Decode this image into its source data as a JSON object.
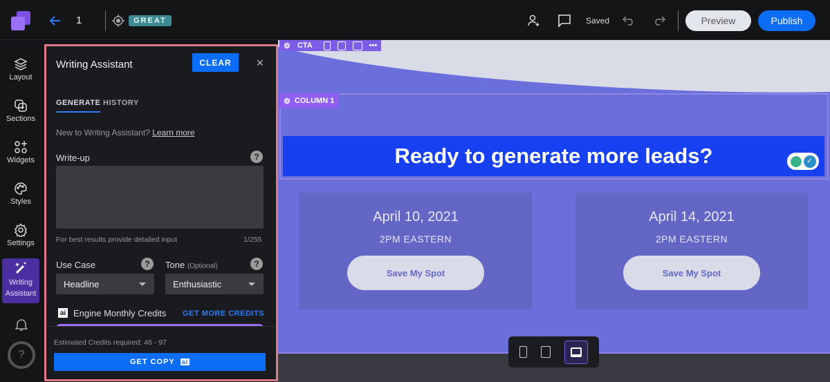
{
  "topbar": {
    "page_number": "1",
    "score_badge": "GREAT",
    "saved": "Saved",
    "preview": "Preview",
    "publish": "Publish"
  },
  "rail": {
    "items": [
      {
        "label": "Layout"
      },
      {
        "label": "Sections"
      },
      {
        "label": "Widgets"
      },
      {
        "label": "Styles"
      },
      {
        "label": "Settings"
      },
      {
        "label": "Writing Assistant"
      }
    ],
    "help": "?"
  },
  "panel": {
    "title": "Writing Assistant",
    "clear": "CLEAR",
    "tabs": [
      "GENERATE",
      "HISTORY"
    ],
    "intro": "New to Writing Assistant?",
    "learn_more": "Learn more",
    "writeup_label": "Write-up",
    "writeup_value": "",
    "hint": "For best results provide detailed input",
    "counter": "1/255",
    "use_case_label": "Use Case",
    "use_case_value": "Headline",
    "tone_label": "Tone",
    "tone_optional": "(Optional)",
    "tone_value": "Enthusiastic",
    "ai_badge": "ai",
    "credits_label": "Engine Monthly Credits",
    "get_more": "GET MORE CREDITS",
    "estimate": "Estimated Credits required: 46 - 97",
    "get_copy": "GET COPY"
  },
  "canvas": {
    "cta_tag": "CTA",
    "column_tag": "COLUMN 1",
    "headline": "Ready to generate more leads?",
    "cards": [
      {
        "date": "April 10, 2021",
        "time": "2PM EASTERN",
        "button": "Save My Spot"
      },
      {
        "date": "April 14, 2021",
        "time": "2PM EASTERN",
        "button": "Save My Spot"
      }
    ]
  },
  "colors": {
    "accent": "#0b6cf5",
    "canvas_bg": "#6b6fdc",
    "headline_bg": "#1640f0",
    "panel_border": "#e07a8a",
    "rail_active": "#4b2fa0"
  }
}
